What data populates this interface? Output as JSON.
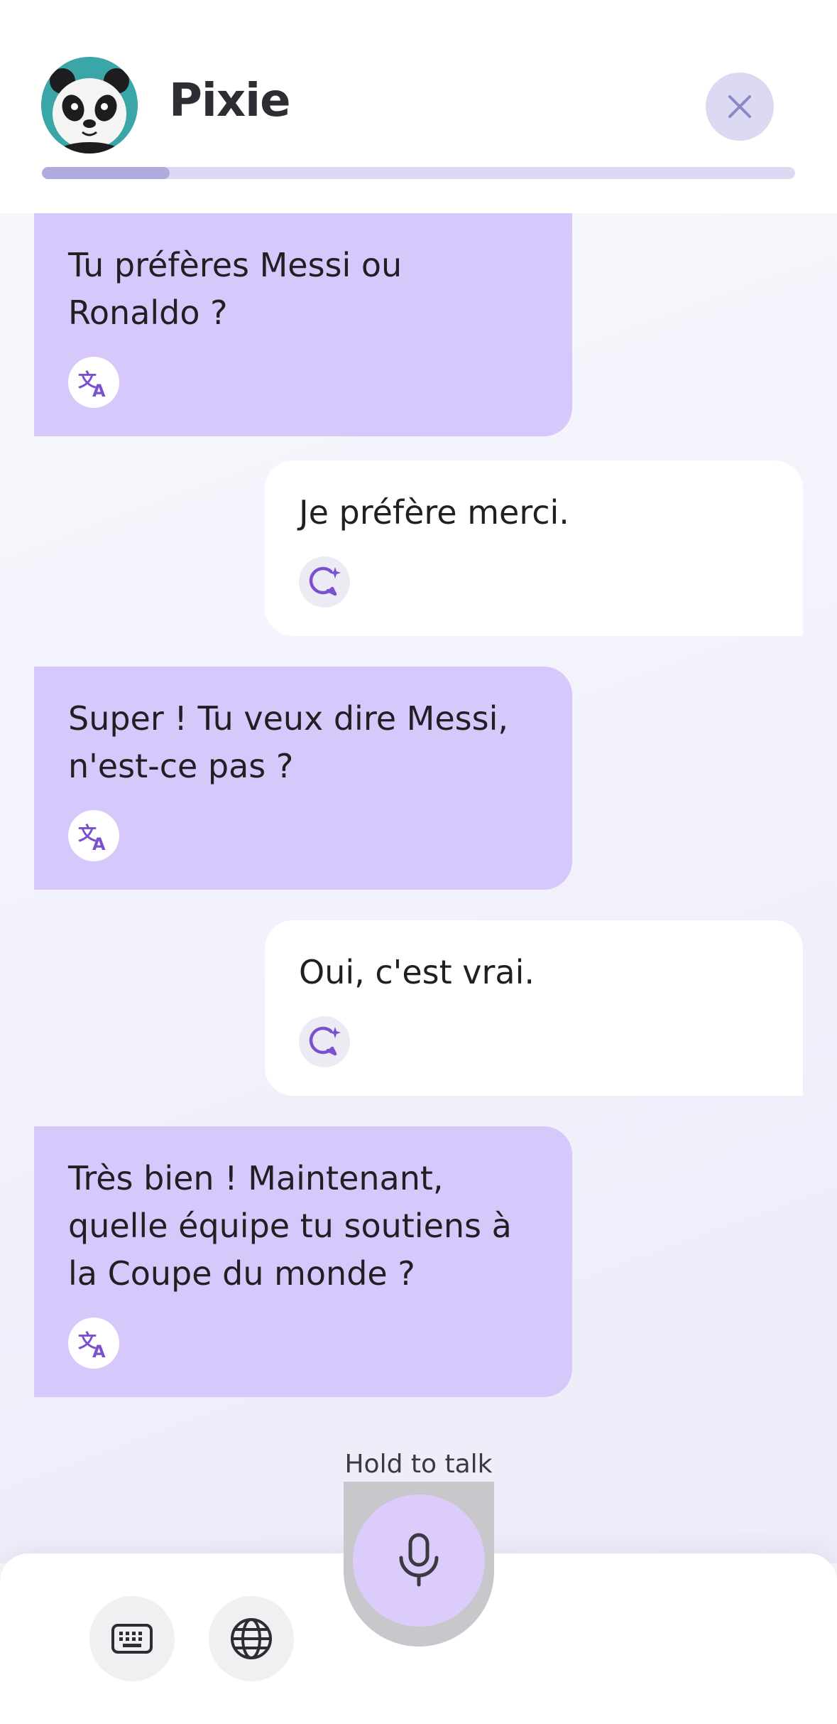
{
  "header": {
    "title": "Pixie",
    "progress": 0.17,
    "close_icon": "close-icon"
  },
  "messages": [
    {
      "role": "bot",
      "text_lines": [
        "Tu préfères Messi ou",
        "Ronaldo ?"
      ],
      "icon": "translate-icon"
    },
    {
      "role": "user",
      "text_lines": [
        "Je préfère merci."
      ],
      "icon": "feedback-sparkle-icon"
    },
    {
      "role": "bot",
      "text_lines": [
        "Super ! Tu veux dire Messi,",
        "n'est-ce pas ?"
      ],
      "icon": "translate-icon"
    },
    {
      "role": "user",
      "text_lines": [
        "Oui, c'est vrai."
      ],
      "icon": "feedback-sparkle-icon"
    },
    {
      "role": "bot",
      "text_lines": [
        "Très bien ! Maintenant,",
        "quelle équipe tu soutiens à",
        "la Coupe du monde ?"
      ],
      "icon": "translate-icon"
    }
  ],
  "footer": {
    "hold_label": "Hold to talk",
    "mic_icon": "microphone-icon",
    "keyboard_icon": "keyboard-icon",
    "globe_icon": "globe-icon"
  },
  "colors": {
    "bot_bubble": "#d7c8fb",
    "user_bubble": "#ffffff",
    "accent_purple": "#7a4fd0",
    "progress_track": "#dcdaf2",
    "progress_fill": "#aeabde"
  }
}
